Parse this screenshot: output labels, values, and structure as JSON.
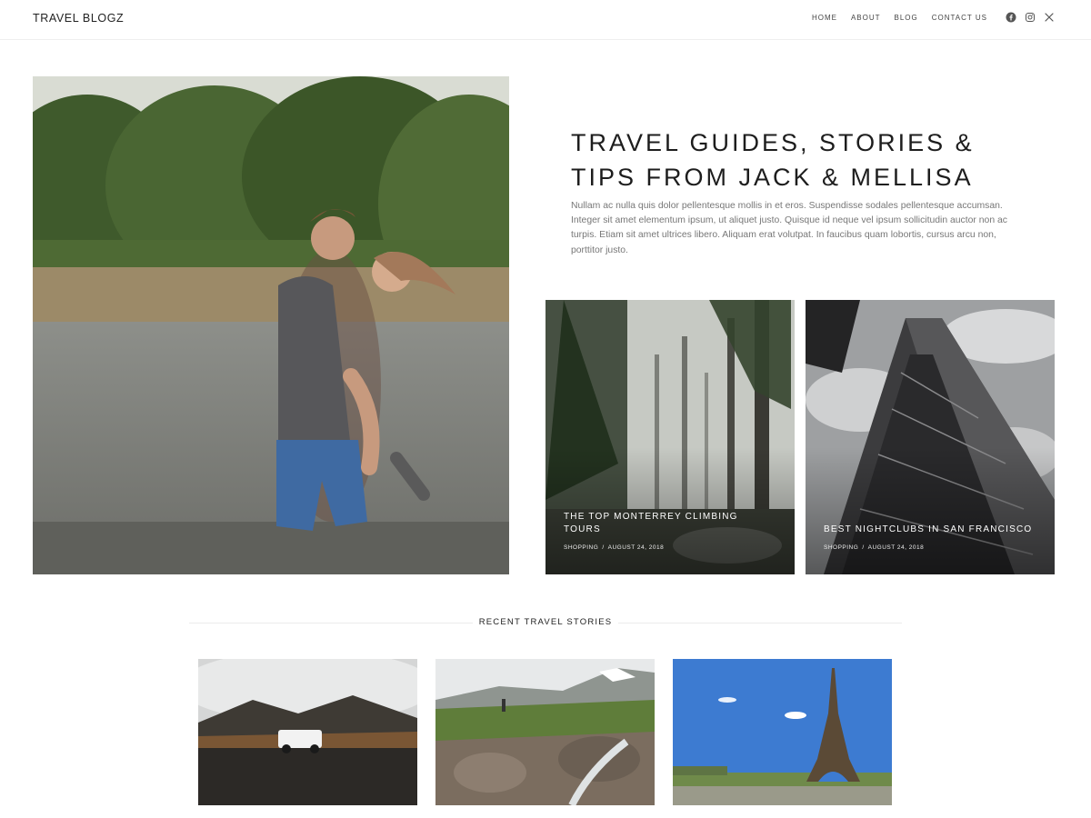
{
  "header": {
    "logo": "TRAVEL BLOGZ",
    "nav": [
      {
        "label": "HOME"
      },
      {
        "label": "ABOUT"
      },
      {
        "label": "BLOG"
      },
      {
        "label": "CONTACT US"
      }
    ],
    "social_icons": [
      "facebook-icon",
      "instagram-icon",
      "x-icon"
    ]
  },
  "intro": {
    "title_line1": "TRAVEL GUIDES, STORIES &",
    "title_line2": "TIPS FROM JACK & MELLISA",
    "text": "Nullam ac nulla quis dolor pellentesque mollis in et eros. Suspendisse sodales pellentesque accumsan. Integer sit amet elementum ipsum, ut aliquet justo. Quisque id neque vel ipsum sollicitudin auctor non ac turpis. Etiam sit amet ultrices libero. Aliquam erat volutpat. In faucibus quam lobortis, cursus arcu non, porttitor justo."
  },
  "featured": [
    {
      "title": "THE TOP MONTERREY CLIMBING TOURS",
      "category": "SHOPPING",
      "separator": "/",
      "date": "AUGUST 24, 2018"
    },
    {
      "title": "BEST NIGHTCLUBS IN SAN FRANCISCO",
      "category": "SHOPPING",
      "separator": "/",
      "date": "AUGUST 24, 2018"
    }
  ],
  "recent": {
    "heading": "RECENT TRAVEL STORIES"
  },
  "colors": {
    "text": "#222222",
    "muted": "#777777",
    "divider": "#ebebeb"
  }
}
